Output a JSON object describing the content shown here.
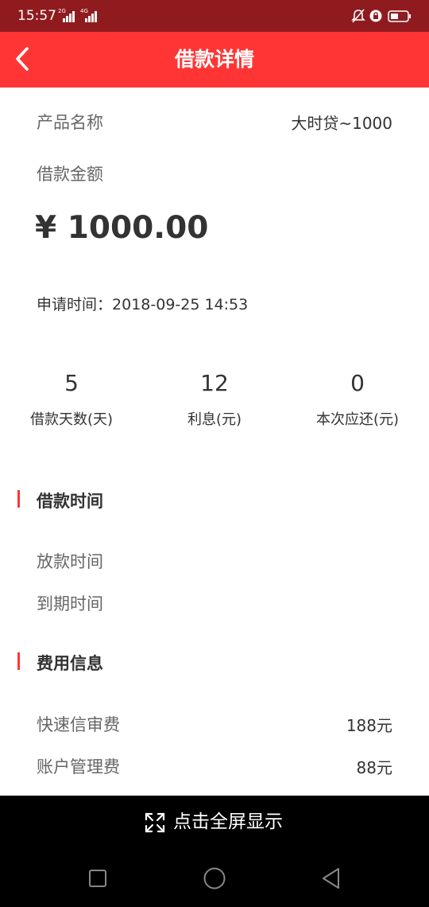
{
  "status_bar": {
    "time": "15:57",
    "sim1_network": "2G",
    "sim2_network": "4G",
    "icons": [
      "signal-icon",
      "mute-bell-icon",
      "rotation-lock-icon",
      "battery-icon"
    ]
  },
  "header": {
    "title": "借款详情",
    "back_icon": "chevron-left-icon",
    "background_color": "#ff3535"
  },
  "product": {
    "label": "产品名称",
    "value": "大时贷~1000"
  },
  "loan_amount": {
    "label": "借款金额",
    "value": "¥ 1000.00"
  },
  "apply_time": {
    "label": "申请时间：",
    "value": "2018-09-25 14:53"
  },
  "stats": [
    {
      "value": "5",
      "label": "借款天数(天)"
    },
    {
      "value": "12",
      "label": "利息(元)"
    },
    {
      "value": "0",
      "label": "本次应还(元)"
    }
  ],
  "loan_time_section": {
    "title": "借款时间",
    "rows": [
      {
        "label": "放款时间"
      },
      {
        "label": "到期时间"
      }
    ]
  },
  "fee_section": {
    "title": "费用信息",
    "rows": [
      {
        "label": "快速信审费",
        "value": "188元"
      },
      {
        "label": "账户管理费",
        "value": "88元"
      }
    ]
  },
  "fullscreen_bar": {
    "label": "点击全屏显示",
    "icon": "expand-icon"
  },
  "nav_bar": {
    "buttons": [
      "recent-apps-icon",
      "home-icon",
      "back-triangle-icon"
    ]
  },
  "colors": {
    "accent": "#ff3535",
    "status_bar": "#8f1b1f",
    "text_primary": "#333333",
    "text_secondary": "#666666"
  }
}
